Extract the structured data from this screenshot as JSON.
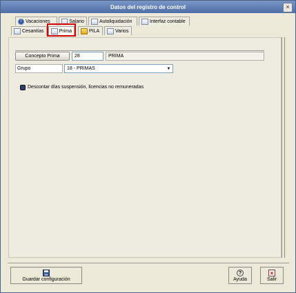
{
  "window": {
    "title": "Datos del registro de control",
    "close_glyph": "×"
  },
  "tabs": {
    "row1": [
      {
        "label": "Vacaciones",
        "icon": "info-icon",
        "glyph": "i"
      },
      {
        "label": "Salario",
        "icon": "puzzle-icon",
        "glyph": ""
      },
      {
        "label": "Autoliquidación",
        "icon": "document-icon",
        "glyph": ""
      },
      {
        "label": "Interfaz contable",
        "icon": "table-icon",
        "glyph": ""
      }
    ],
    "row2": [
      {
        "label": "Cesantías",
        "icon": "table-icon",
        "glyph": ""
      },
      {
        "label": "Prima",
        "icon": "table-icon",
        "glyph": "",
        "active": true
      },
      {
        "label": "PILA",
        "icon": "grid-icon",
        "glyph": ""
      },
      {
        "label": "Varios",
        "icon": "table-icon",
        "glyph": ""
      }
    ]
  },
  "form": {
    "concepto_button": "Concepto Prima",
    "concepto_code": "28",
    "concepto_name": "PRIMA",
    "grupo_label": "Grupo",
    "grupo_value": "18 - PRIMAS",
    "dropdown_glyph": "▼",
    "checkbox_label": "Descontar días suspensión, licencias no remuneradas",
    "checkbox_checked": true
  },
  "footer": {
    "save_label": "Guardar configuración",
    "help_label": "Ayuda",
    "help_glyph": "?",
    "exit_label": "Salir",
    "exit_glyph": "×"
  }
}
